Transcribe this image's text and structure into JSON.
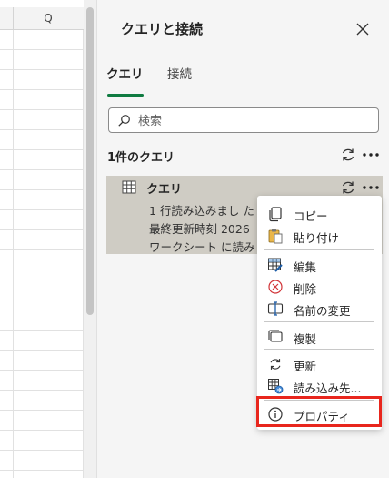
{
  "sheet": {
    "column_header": "Q"
  },
  "pane": {
    "title": "クエリと接続",
    "tabs": [
      {
        "label": "クエリ"
      },
      {
        "label": "接続"
      }
    ],
    "search": {
      "placeholder": "検索",
      "value": ""
    },
    "section_header": "1件のクエリ",
    "query": {
      "name": "クエリ",
      "line1": "1 行読み込みまし た",
      "line2": "最終更新時刻 2026",
      "line3": "ワークシート に読み"
    }
  },
  "context_menu": {
    "items": [
      {
        "label": "コピー",
        "icon": "copy-icon"
      },
      {
        "label": "貼り付け",
        "icon": "paste-icon"
      },
      {
        "label": "編集",
        "icon": "edit-table-icon"
      },
      {
        "label": "削除",
        "icon": "delete-icon"
      },
      {
        "label": "名前の変更",
        "icon": "rename-icon"
      },
      {
        "label": "複製",
        "icon": "duplicate-icon"
      },
      {
        "label": "更新",
        "icon": "refresh-icon"
      },
      {
        "label": "読み込み先...",
        "icon": "load-to-icon"
      },
      {
        "label": "プロパティ",
        "icon": "info-icon"
      }
    ]
  },
  "colors": {
    "accent_green": "#0f7b41",
    "highlight_red": "#e8261d",
    "query_card_bg": "#cfccc4",
    "pane_bg": "#f5f5f5"
  }
}
